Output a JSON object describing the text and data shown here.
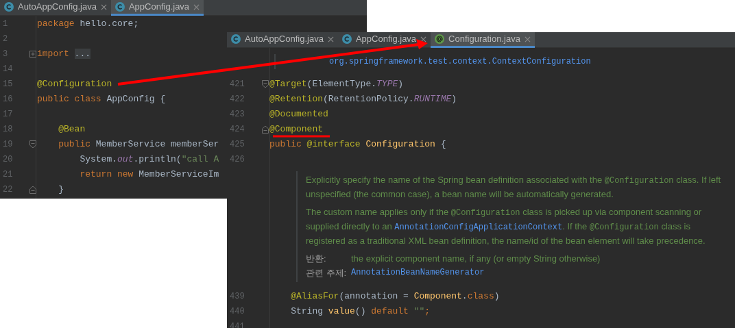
{
  "windows": [
    {
      "tabs": [
        {
          "label": "AutoAppConfig.java",
          "kind": "class",
          "selected": false
        },
        {
          "label": "AppConfig.java",
          "kind": "class",
          "selected": true
        }
      ],
      "blocks": [
        {
          "kind": "code",
          "lines": [
            {
              "number": "1",
              "kind": "plain",
              "tokens": [
                {
                  "kind": "kw",
                  "text": "package"
                },
                {
                  "kind": "plain",
                  "text": " hello.core;"
                }
              ]
            },
            {
              "number": "2",
              "kind": "plain"
            },
            {
              "number": "3",
              "kind": "fold_expand",
              "tokens": [
                {
                  "kind": "kw",
                  "text": "import "
                },
                {
                  "kind": "folded",
                  "text": "..."
                }
              ]
            },
            {
              "number": "14",
              "kind": "plain"
            },
            {
              "number": "15",
              "kind": "plain",
              "tokens": [
                {
                  "kind": "ann",
                  "text": "@Configuration"
                }
              ]
            },
            {
              "number": "16",
              "kind": "plain",
              "tokens": [
                {
                  "kind": "kw",
                  "text": "public class"
                },
                {
                  "kind": "plain",
                  "text": " AppConfig {"
                }
              ]
            },
            {
              "number": "17",
              "kind": "plain"
            },
            {
              "number": "18",
              "kind": "plain",
              "tokens": [
                {
                  "kind": "ann",
                  "text": "    @Bean"
                }
              ]
            },
            {
              "number": "19",
              "kind": "fold_start",
              "tokens": [
                {
                  "kind": "kw",
                  "text": "    public"
                },
                {
                  "kind": "plain",
                  "text": " MemberService memberSer"
                }
              ]
            },
            {
              "number": "20",
              "kind": "plain",
              "tokens": [
                {
                  "kind": "plain",
                  "text": "        System."
                },
                {
                  "kind": "static",
                  "text": "out"
                },
                {
                  "kind": "plain",
                  "text": ".println("
                },
                {
                  "kind": "str",
                  "text": "\"call A"
                }
              ]
            },
            {
              "number": "21",
              "kind": "plain",
              "tokens": [
                {
                  "kind": "kw",
                  "text": "        return new"
                },
                {
                  "kind": "plain",
                  "text": " MemberServiceIm"
                }
              ]
            },
            {
              "number": "22",
              "kind": "fold_end",
              "tokens": [
                {
                  "kind": "plain",
                  "text": "    }"
                }
              ]
            }
          ]
        }
      ]
    },
    {
      "tabs": [
        {
          "label": "AutoAppConfig.java",
          "kind": "class",
          "selected": false
        },
        {
          "label": "AppConfig.java",
          "kind": "class",
          "selected": false
        },
        {
          "label": "Configuration.java",
          "kind": "annotation",
          "selected": true
        }
      ],
      "blocks": [
        {
          "kind": "imports",
          "lines": [
            "org.springframework.test.context.ContextConfiguration"
          ]
        },
        {
          "kind": "code",
          "lines": [
            {
              "number": "421",
              "kind": "fold_start",
              "tokens": [
                {
                  "kind": "ann",
                  "text": "@Target"
                },
                {
                  "kind": "plain",
                  "text": "(ElementType."
                },
                {
                  "kind": "static",
                  "text": "TYPE"
                },
                {
                  "kind": "plain",
                  "text": ")"
                }
              ]
            },
            {
              "number": "422",
              "kind": "plain",
              "tokens": [
                {
                  "kind": "ann",
                  "text": "@Retention"
                },
                {
                  "kind": "plain",
                  "text": "(RetentionPolicy."
                },
                {
                  "kind": "static",
                  "text": "RUNTIME"
                },
                {
                  "kind": "plain",
                  "text": ")"
                }
              ]
            },
            {
              "number": "423",
              "kind": "plain",
              "tokens": [
                {
                  "kind": "ann",
                  "text": "@Documented"
                }
              ]
            },
            {
              "number": "424",
              "kind": "fold_end",
              "tokens": [
                {
                  "kind": "ann",
                  "text": "@Component"
                }
              ]
            },
            {
              "number": "425",
              "kind": "plain",
              "tokens": [
                {
                  "kind": "kw",
                  "text": "public "
                },
                {
                  "kind": "ann",
                  "text": "@interface "
                },
                {
                  "kind": "decl",
                  "text": "Configuration"
                },
                {
                  "kind": "plain",
                  "text": " {"
                }
              ]
            },
            {
              "number": "426",
              "kind": "plain"
            }
          ]
        },
        {
          "kind": "doc",
          "paragraphs": [
            [
              {
                "kind": "text",
                "text": "Explicitly specify the name of the Spring bean definition associated with the "
              },
              {
                "kind": "code",
                "text": "@Configuration"
              },
              {
                "kind": "text",
                "text": " class. If left unspecified (the common case), a bean name will be automatically generated."
              }
            ],
            [
              {
                "kind": "text",
                "text": "The custom name applies only if the "
              },
              {
                "kind": "code",
                "text": "@Configuration"
              },
              {
                "kind": "text",
                "text": " class is picked up via component scanning or supplied directly to an "
              },
              {
                "kind": "link",
                "text": "AnnotationConfigApplicationContext"
              },
              {
                "kind": "text",
                "text": ". If the "
              },
              {
                "kind": "code",
                "text": "@Configuration"
              },
              {
                "kind": "text",
                "text": " class is registered as a traditional XML bean definition, the name/id of the bean element will take precedence."
              }
            ]
          ],
          "sections": [
            {
              "label": "반환:",
              "value": "the explicit component name, if any (or empty String otherwise)",
              "kind": "text"
            },
            {
              "label": "관련 주제:",
              "value": "AnnotationBeanNameGenerator",
              "kind": "link"
            }
          ]
        },
        {
          "kind": "code",
          "lines": [
            {
              "number": "439",
              "kind": "plain",
              "tokens": [
                {
                  "kind": "ann",
                  "text": "    @AliasFor"
                },
                {
                  "kind": "plain",
                  "text": "(annotation = "
                },
                {
                  "kind": "decl",
                  "text": "Component"
                },
                {
                  "kind": "plain",
                  "text": "."
                },
                {
                  "kind": "kw",
                  "text": "class"
                },
                {
                  "kind": "plain",
                  "text": ")"
                }
              ]
            },
            {
              "number": "440",
              "kind": "plain",
              "tokens": [
                {
                  "kind": "plain",
                  "text": "    String "
                },
                {
                  "kind": "decl",
                  "text": "value"
                },
                {
                  "kind": "plain",
                  "text": "() "
                },
                {
                  "kind": "kw",
                  "text": "default "
                },
                {
                  "kind": "str",
                  "text": "\"\""
                },
                {
                  "kind": "kw",
                  "text": ";"
                }
              ]
            },
            {
              "number": "441",
              "kind": "plain"
            }
          ]
        }
      ]
    }
  ]
}
